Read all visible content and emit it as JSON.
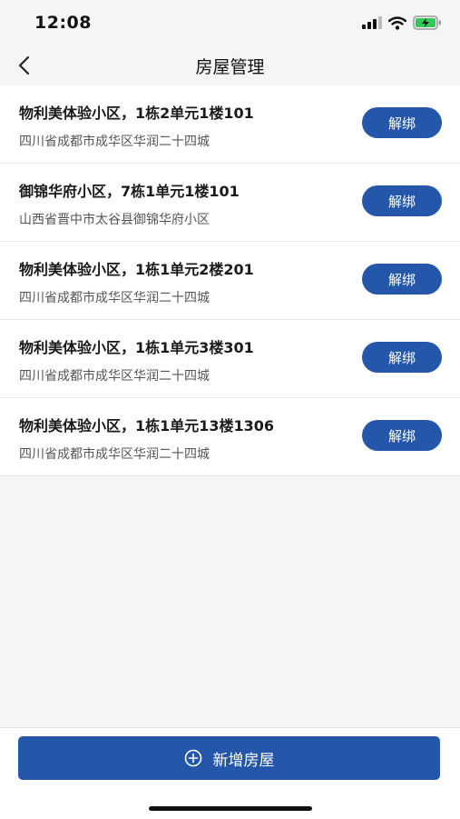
{
  "status_bar": {
    "time": "12:08",
    "icons": [
      "signal-icon",
      "wifi-icon",
      "battery-charging-icon"
    ]
  },
  "nav": {
    "title": "房屋管理",
    "back_icon": "chevron-left-icon"
  },
  "houses": [
    {
      "title": "物利美体验小区，1栋2单元1楼101",
      "address": "四川省成都市成华区华润二十四城",
      "action": "解绑"
    },
    {
      "title": "御锦华府小区，7栋1单元1楼101",
      "address": "山西省晋中市太谷县御锦华府小区",
      "action": "解绑"
    },
    {
      "title": "物利美体验小区，1栋1单元2楼201",
      "address": "四川省成都市成华区华润二十四城",
      "action": "解绑"
    },
    {
      "title": "物利美体验小区，1栋1单元3楼301",
      "address": "四川省成都市成华区华润二十四城",
      "action": "解绑"
    },
    {
      "title": "物利美体验小区，1栋1单元13楼1306",
      "address": "四川省成都市成华区华润二十四城",
      "action": "解绑"
    }
  ],
  "add_button": {
    "label": "新增房屋",
    "icon": "plus-circle-icon"
  },
  "colors": {
    "primary": "#2457a9",
    "background": "#f5f5f5",
    "battery": "#34c759"
  }
}
